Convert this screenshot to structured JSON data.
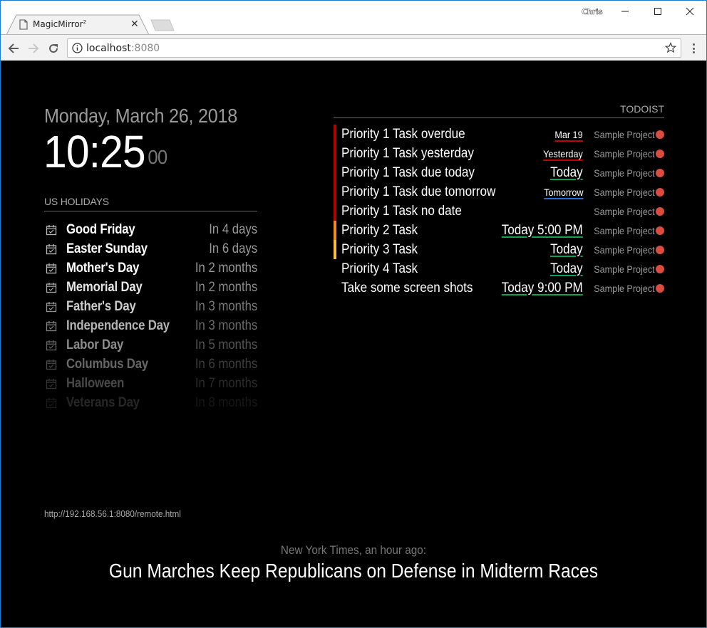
{
  "browser": {
    "tab_title": "MagicMirror",
    "tab_title_sup": "2",
    "profile_name": "Chris",
    "url_host": "localhost",
    "url_port": ":8080"
  },
  "clock": {
    "date": "Monday, March 26, 2018",
    "time": "10:25",
    "seconds": "00"
  },
  "holidays": {
    "header": "US HOLIDAYS",
    "items": [
      {
        "name": "Good Friday",
        "when": "In 4 days",
        "opacity": 1.0
      },
      {
        "name": "Easter Sunday",
        "when": "In 6 days",
        "opacity": 1.0
      },
      {
        "name": "Mother's Day",
        "when": "In 2 months",
        "opacity": 1.0
      },
      {
        "name": "Memorial Day",
        "when": "In 2 months",
        "opacity": 0.9
      },
      {
        "name": "Father's Day",
        "when": "In 3 months",
        "opacity": 0.8
      },
      {
        "name": "Independence Day",
        "when": "In 3 months",
        "opacity": 0.7
      },
      {
        "name": "Labor Day",
        "when": "In 5 months",
        "opacity": 0.55
      },
      {
        "name": "Columbus Day",
        "when": "In 6 months",
        "opacity": 0.4
      },
      {
        "name": "Halloween",
        "when": "In 7 months",
        "opacity": 0.28
      },
      {
        "name": "Veterans Day",
        "when": "In 8 months",
        "opacity": 0.15
      }
    ]
  },
  "todoist": {
    "header": "TODOIST",
    "project_color": "#db4c3f",
    "items": [
      {
        "title": "Priority 1 Task overdue",
        "due": "Mar 19",
        "due_size": "small",
        "due_color": "#c00000",
        "priority_color": "#b40000",
        "project": "Sample Project"
      },
      {
        "title": "Priority 1 Task yesterday",
        "due": "Yesterday",
        "due_size": "small",
        "due_color": "#c00000",
        "priority_color": "#b40000",
        "project": "Sample Project"
      },
      {
        "title": "Priority 1 Task due today",
        "due": "Today",
        "due_size": "big",
        "due_color": "#0ea352",
        "priority_color": "#b40000",
        "project": "Sample Project"
      },
      {
        "title": "Priority 1 Task due tomorrow",
        "due": "Tomorrow",
        "due_size": "small",
        "due_color": "#246fe0",
        "priority_color": "#b40000",
        "project": "Sample Project"
      },
      {
        "title": "Priority 1 Task no date",
        "due": "",
        "due_size": "small",
        "due_color": "",
        "priority_color": "#b40000",
        "project": "Sample Project"
      },
      {
        "title": "Priority 2 Task",
        "due": "Today 5:00 PM",
        "due_size": "big",
        "due_color": "#0ea352",
        "priority_color": "#f28b20",
        "project": "Sample Project"
      },
      {
        "title": "Priority 3 Task",
        "due": "Today",
        "due_size": "big",
        "due_color": "#0ea352",
        "priority_color": "#f8c33a",
        "project": "Sample Project"
      },
      {
        "title": "Priority 4 Task",
        "due": "Today",
        "due_size": "big",
        "due_color": "#0ea352",
        "priority_color": "",
        "project": "Sample Project"
      },
      {
        "title": "Take some screen shots",
        "due": "Today 9:00 PM",
        "due_size": "big",
        "due_color": "#0ea352",
        "priority_color": "",
        "project": "Sample Project"
      }
    ]
  },
  "remote": {
    "url": "http://192.168.56.1:8080/remote.html"
  },
  "news": {
    "source": "New York Times, an hour ago:",
    "headline": "Gun Marches Keep Republicans on Defense in Midterm Races"
  }
}
